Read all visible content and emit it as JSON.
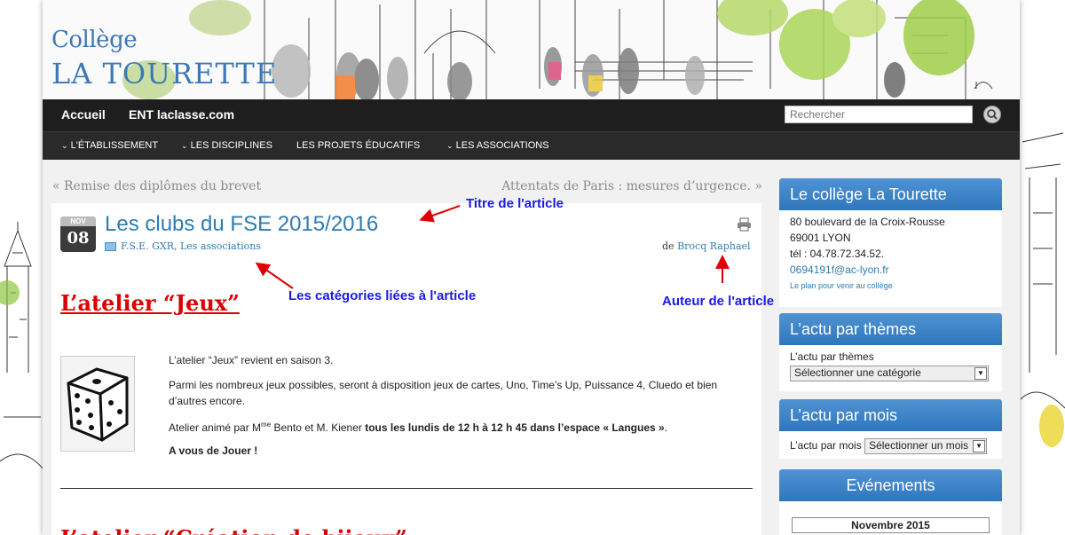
{
  "site": {
    "logo_line1": "Collège",
    "logo_line2": "LA TOURETTE"
  },
  "nav_main": {
    "accueil": "Accueil",
    "ent": "ENT laclasse.com"
  },
  "search": {
    "placeholder": "Rechercher"
  },
  "nav_sub": [
    {
      "label": "L'ÉTABLISSEMENT",
      "chevron": true
    },
    {
      "label": "LES DISCIPLINES",
      "chevron": true
    },
    {
      "label": "LES PROJETS ÉDUCATIFS",
      "chevron": false
    },
    {
      "label": "LES ASSOCIATIONS",
      "chevron": true
    }
  ],
  "post_nav": {
    "prev": "« Remise des diplômes du brevet",
    "next": "Attentats de Paris : mesures d’urgence. »"
  },
  "article": {
    "date_month": "NOV",
    "date_day": "08",
    "title": "Les clubs du FSE 2015/2016",
    "categories": [
      "F.S.E. GXR",
      "Les associations"
    ],
    "author_prefix": "de",
    "author": "Brocq Raphael",
    "heading1": "L’atelier “Jeux”",
    "p1": "L’atelier “Jeux” revient en saison 3.",
    "p2": "Parmi les nombreux jeux possibles, seront à disposition jeux de cartes, Uno, Time’s Up, Puissance 4, Cluedo et bien d’autres encore.",
    "p3_a": "Atelier animé par M",
    "p3_sup": "me",
    "p3_b": " Bento et M. Kiener ",
    "p3_bold": "tous les lundis de 12 h à 12 h 45 dans l’espace « Langues »",
    "p3_end": ".",
    "p4": "A vous de Jouer !",
    "heading2": "L’atelier “Création de bijoux”"
  },
  "annotations": {
    "title": "Titre de l'article",
    "categories": "Les catégories liées à l'article",
    "author": "Auteur de l'article"
  },
  "sidebar": {
    "college": {
      "title": "Le collège La Tourette",
      "address1": "80 boulevard de la Croix-Rousse",
      "address2": "69001 LYON",
      "phone": "tél : 04.78.72.34.52.",
      "email": "0694191f@ac-lyon.fr",
      "plan": "Le plan pour venir au collège"
    },
    "themes": {
      "title": "L’actu par thèmes",
      "label": "L’actu par thèmes",
      "select": "Sélectionner une catégorie"
    },
    "months": {
      "title": "L’actu par mois",
      "label": "L’actu par mois",
      "select": "Sélectionner un mois"
    },
    "events": {
      "title": "Evénements",
      "calendar": "Novembre  2015"
    }
  },
  "colors": {
    "accent": "#2f7bb1",
    "heading_red": "#dd0000",
    "annotation_blue": "#1a1ae6",
    "nav_dark": "#1e1e1e"
  }
}
